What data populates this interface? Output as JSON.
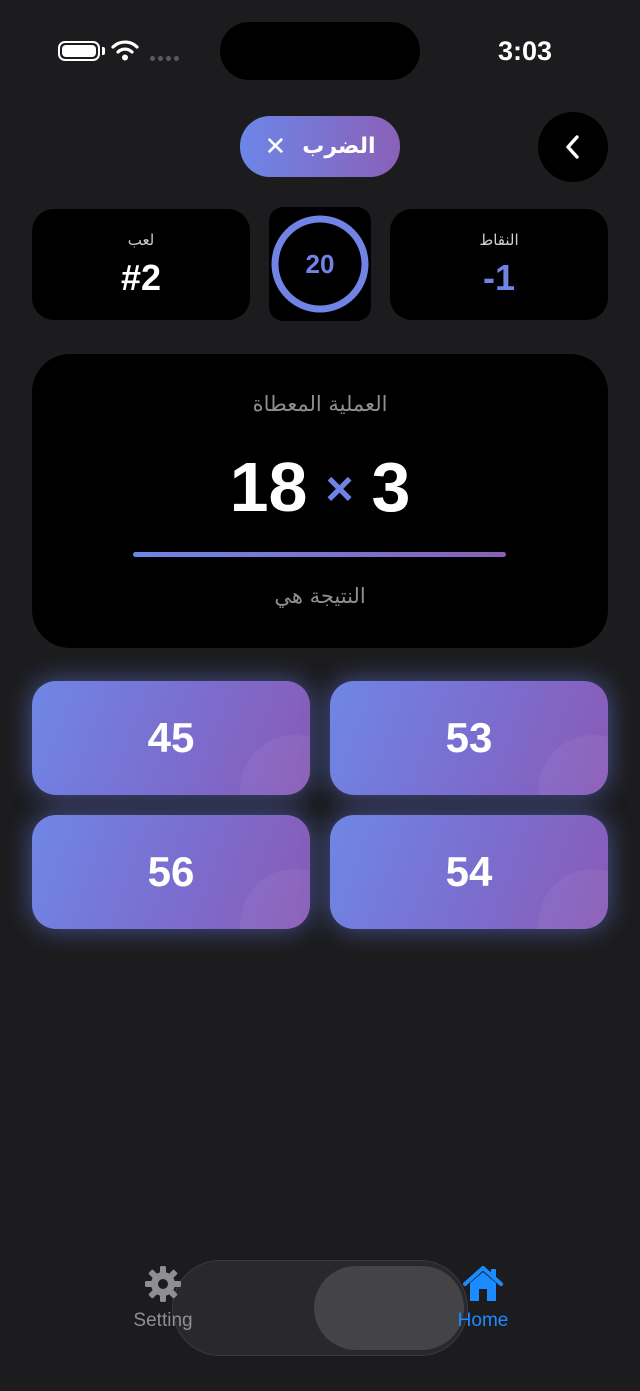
{
  "status_bar": {
    "time": "3:03"
  },
  "header": {
    "mode_label": "الضرب",
    "close_symbol": "✕",
    "back_icon": "chevron-left-icon"
  },
  "stats": {
    "game_label": "لعب",
    "game_value": "#2",
    "timer_value": "20",
    "points_label": "النقاط",
    "points_value": "-1"
  },
  "question": {
    "title": "العملية المعطاة",
    "operand_left": "18",
    "operator": "×",
    "operand_right": "3",
    "result_label": "النتيجة هي"
  },
  "answers": [
    "45",
    "53",
    "56",
    "54"
  ],
  "tab_bar": {
    "items": [
      {
        "label": "Setting",
        "icon": "gear-icon"
      },
      {
        "label": "Home",
        "icon": "home-icon",
        "active": true
      }
    ]
  },
  "colors": {
    "background": "#1c1c1e",
    "card": "#000000",
    "accent": "#7283e6",
    "gradient_start": "#6c86e8",
    "gradient_end": "#8a60b8",
    "active_tab": "#1a8cff",
    "muted_text": "#8e8e93"
  }
}
